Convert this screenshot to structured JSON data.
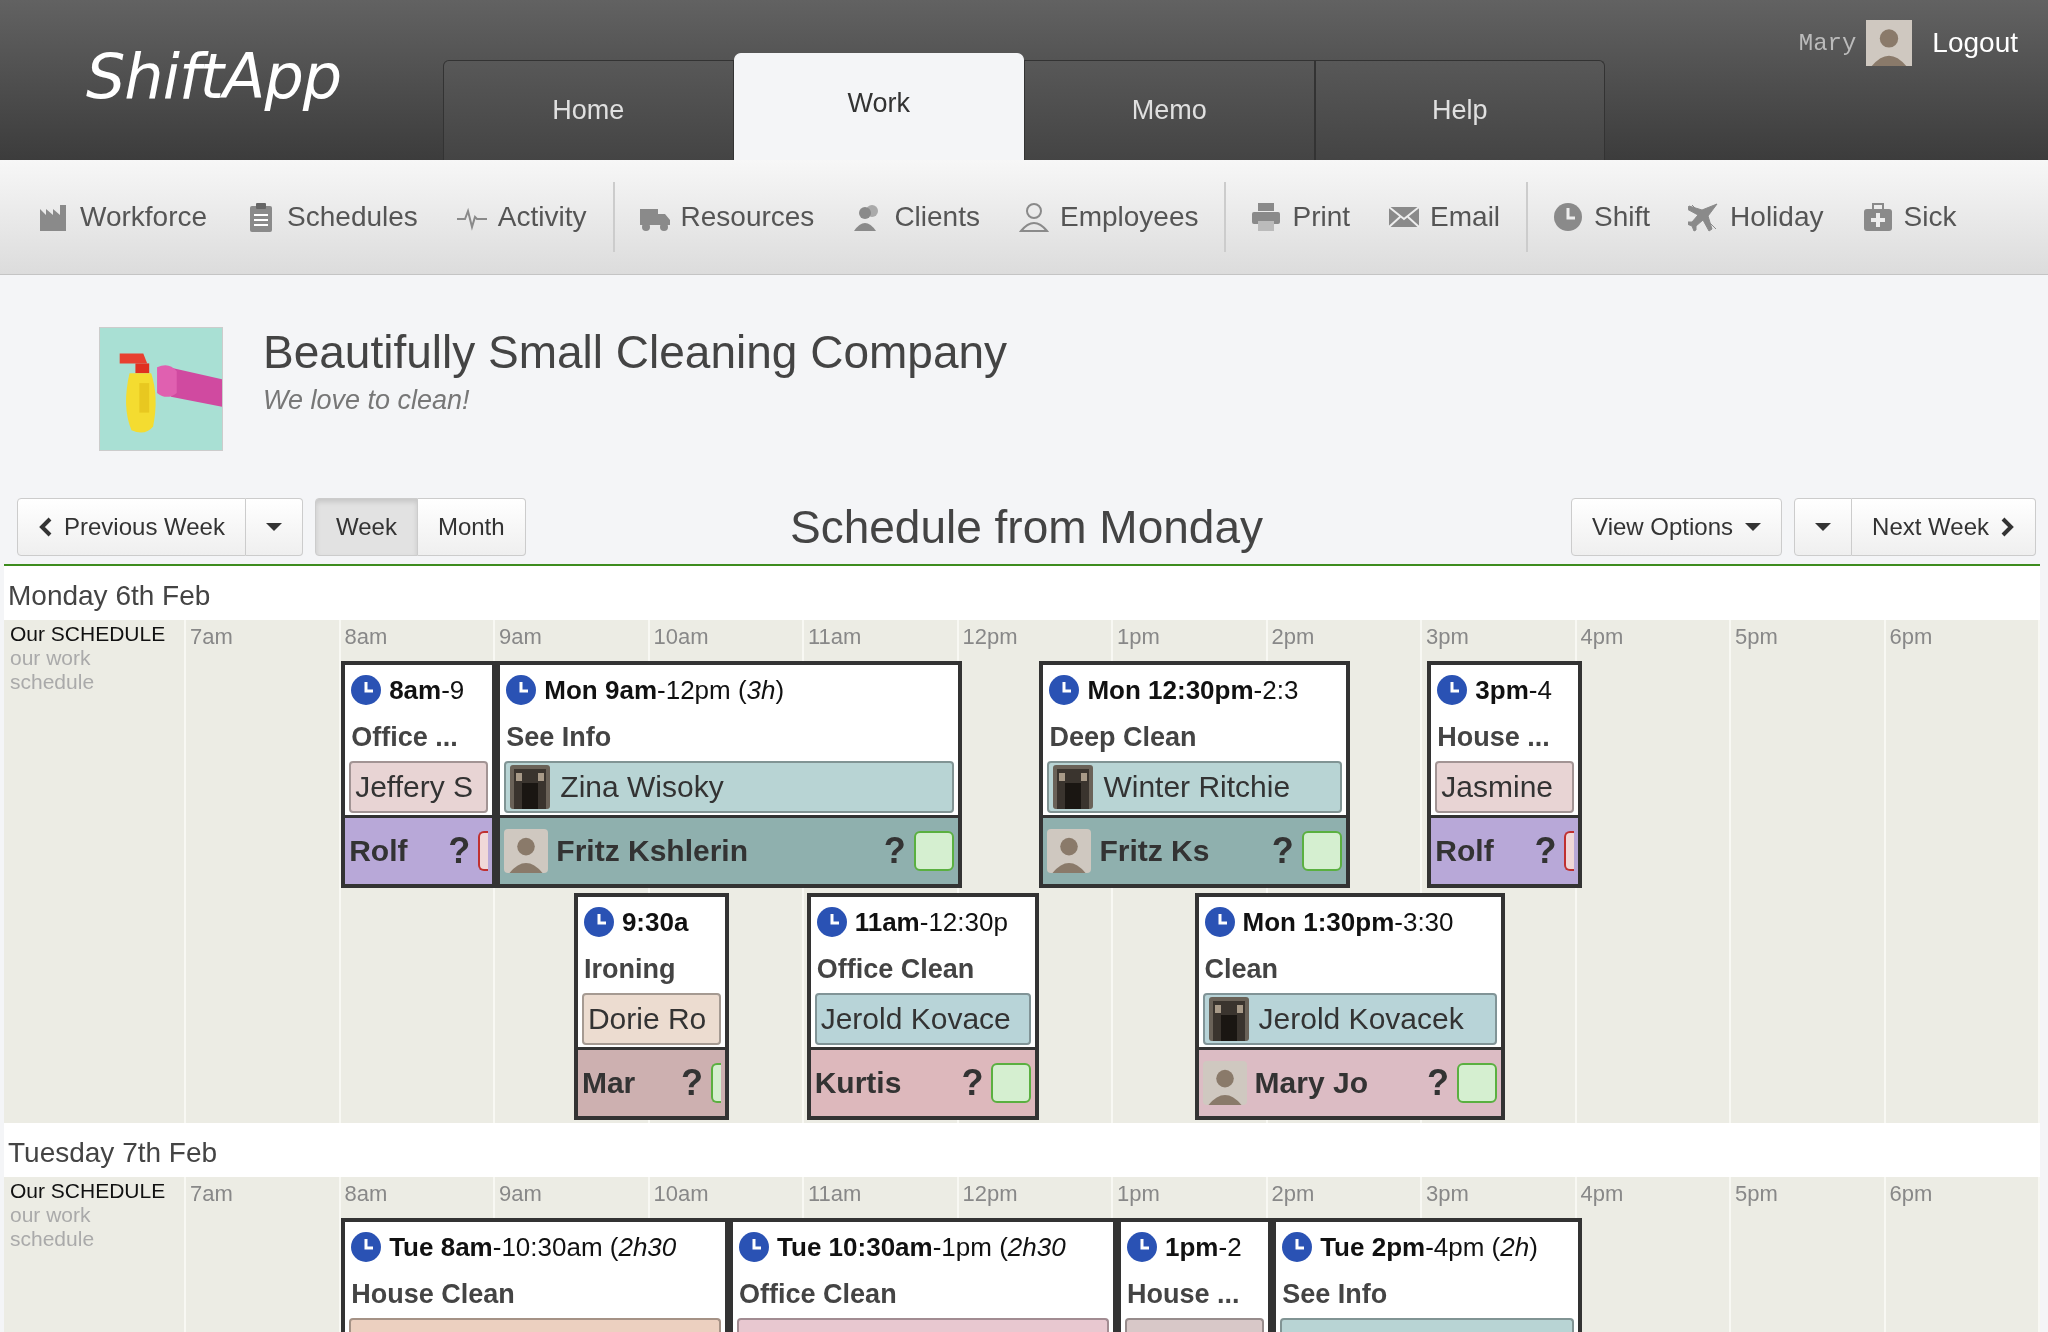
{
  "app": {
    "logo": "ShiftApp"
  },
  "tabs": [
    {
      "label": "Home",
      "selected": false
    },
    {
      "label": "Work",
      "selected": true
    },
    {
      "label": "Memo",
      "selected": false
    },
    {
      "label": "Help",
      "selected": false
    }
  ],
  "user": {
    "name": "Mary",
    "logout": "Logout"
  },
  "toolbar": [
    {
      "items": [
        {
          "label": "Workforce"
        },
        {
          "label": "Schedules"
        },
        {
          "label": "Activity"
        }
      ]
    },
    {
      "items": [
        {
          "label": "Resources"
        },
        {
          "label": "Clients"
        },
        {
          "label": "Employees"
        }
      ]
    },
    {
      "items": [
        {
          "label": "Print"
        },
        {
          "label": "Email"
        }
      ]
    },
    {
      "items": [
        {
          "label": "Shift"
        },
        {
          "label": "Holiday"
        },
        {
          "label": "Sick"
        }
      ]
    }
  ],
  "company": {
    "name": "Beautifully Small Cleaning Company",
    "tagline": "We love to clean!"
  },
  "nav": {
    "previous": "Previous Week",
    "views": [
      {
        "label": "Week",
        "selected": true
      },
      {
        "label": "Month",
        "selected": false
      }
    ],
    "title": "Schedule from Monday",
    "view_options": "View Options",
    "next": "Next Week"
  },
  "days": [
    {
      "date": "Monday 6th Feb",
      "schedule": {
        "name": "Our SCHEDULE",
        "description": "our work schedule"
      },
      "hours": [
        "7am",
        "8am",
        "9am",
        "10am",
        "11am",
        "12pm",
        "1pm",
        "2pm",
        "3pm",
        "4pm",
        "5pm",
        "6pm"
      ],
      "shifts": [
        {
          "time": "**8am**-9",
          "title": "Office ...",
          "staff": {
            "name": "Jeffery S",
            "color": "#e8d4d4",
            "photo": false
          },
          "assignee": {
            "name": "Rolf",
            "color": "#b8a8d8",
            "avatar": false,
            "query": "?",
            "confirmed": false
          }
        },
        {
          "time": "**Mon 9am**-12pm (*3h*)",
          "title": "See Info",
          "staff": {
            "name": "Zina Wisoky",
            "color": "#b8d4d4",
            "photo": true
          },
          "assignee": {
            "name": "Fritz Kshlerin",
            "color": "#8fb0ae",
            "avatar": true,
            "query": "?",
            "confirmed": true
          }
        },
        {
          "time": "**Mon 12:30pm**-2:3",
          "title": "Deep Clean",
          "staff": {
            "name": "Winter Ritchie",
            "color": "#b8d4d4",
            "photo": true
          },
          "assignee": {
            "name": "Fritz Ks",
            "color": "#8fb0ae",
            "avatar": true,
            "query": "?",
            "confirmed": true
          }
        },
        {
          "time": "**3pm**-4",
          "title": "House ...",
          "staff": {
            "name": "Jasmine",
            "color": "#e8d4d4",
            "photo": false
          },
          "assignee": {
            "name": "Rolf",
            "color": "#b8a8d8",
            "avatar": false,
            "query": "?",
            "confirmed": false
          }
        },
        {
          "time": "**9:30a**",
          "title": "Ironing",
          "staff": {
            "name": "Dorie Ro",
            "color": "#ecdcd0",
            "photo": false
          },
          "assignee": {
            "name": "Mar",
            "color": "#cdb0b0",
            "avatar": false,
            "query": "?",
            "confirmed": true
          }
        },
        {
          "time": "**11am**-12:30p",
          "title": "Office Clean",
          "staff": {
            "name": "Jerold Kovace",
            "color": "#b8d4d8",
            "photo": false
          },
          "assignee": {
            "name": "Kurtis",
            "color": "#ddb8bc",
            "avatar": false,
            "query": "?",
            "confirmed": true
          }
        },
        {
          "time": "**Mon 1:30pm**-3:30",
          "title": "Clean",
          "staff": {
            "name": "Jerold Kovacek",
            "color": "#b8d4d8",
            "photo": true
          },
          "assignee": {
            "name": "Mary Jo",
            "color": "#dcbcc4",
            "avatar": true,
            "query": "?",
            "confirmed": true
          }
        }
      ]
    },
    {
      "date": "Tuesday 7th Feb",
      "schedule": {
        "name": "Our SCHEDULE",
        "description": "our work schedule"
      },
      "hours": [
        "7am",
        "8am",
        "9am",
        "10am",
        "11am",
        "12pm",
        "1pm",
        "2pm",
        "3pm",
        "4pm",
        "5pm",
        "6pm"
      ],
      "shifts": [
        {
          "time": "**Tue 8am**-10:30am (*2h30*",
          "title": "House Clean",
          "staff": {
            "color": "#ecd0c0"
          }
        },
        {
          "time": "**Tue 10:30am**-1pm (*2h30*",
          "title": "Office Clean",
          "staff": {
            "color": "#e8c8d0"
          }
        },
        {
          "time": "**1pm**-2",
          "title": "House ...",
          "staff": {
            "color": "#d8c8c8"
          }
        },
        {
          "time": "**Tue 2pm**-4pm (*2h*)",
          "title": "See Info",
          "staff": {
            "color": "#b8d4d4"
          }
        }
      ]
    }
  ]
}
